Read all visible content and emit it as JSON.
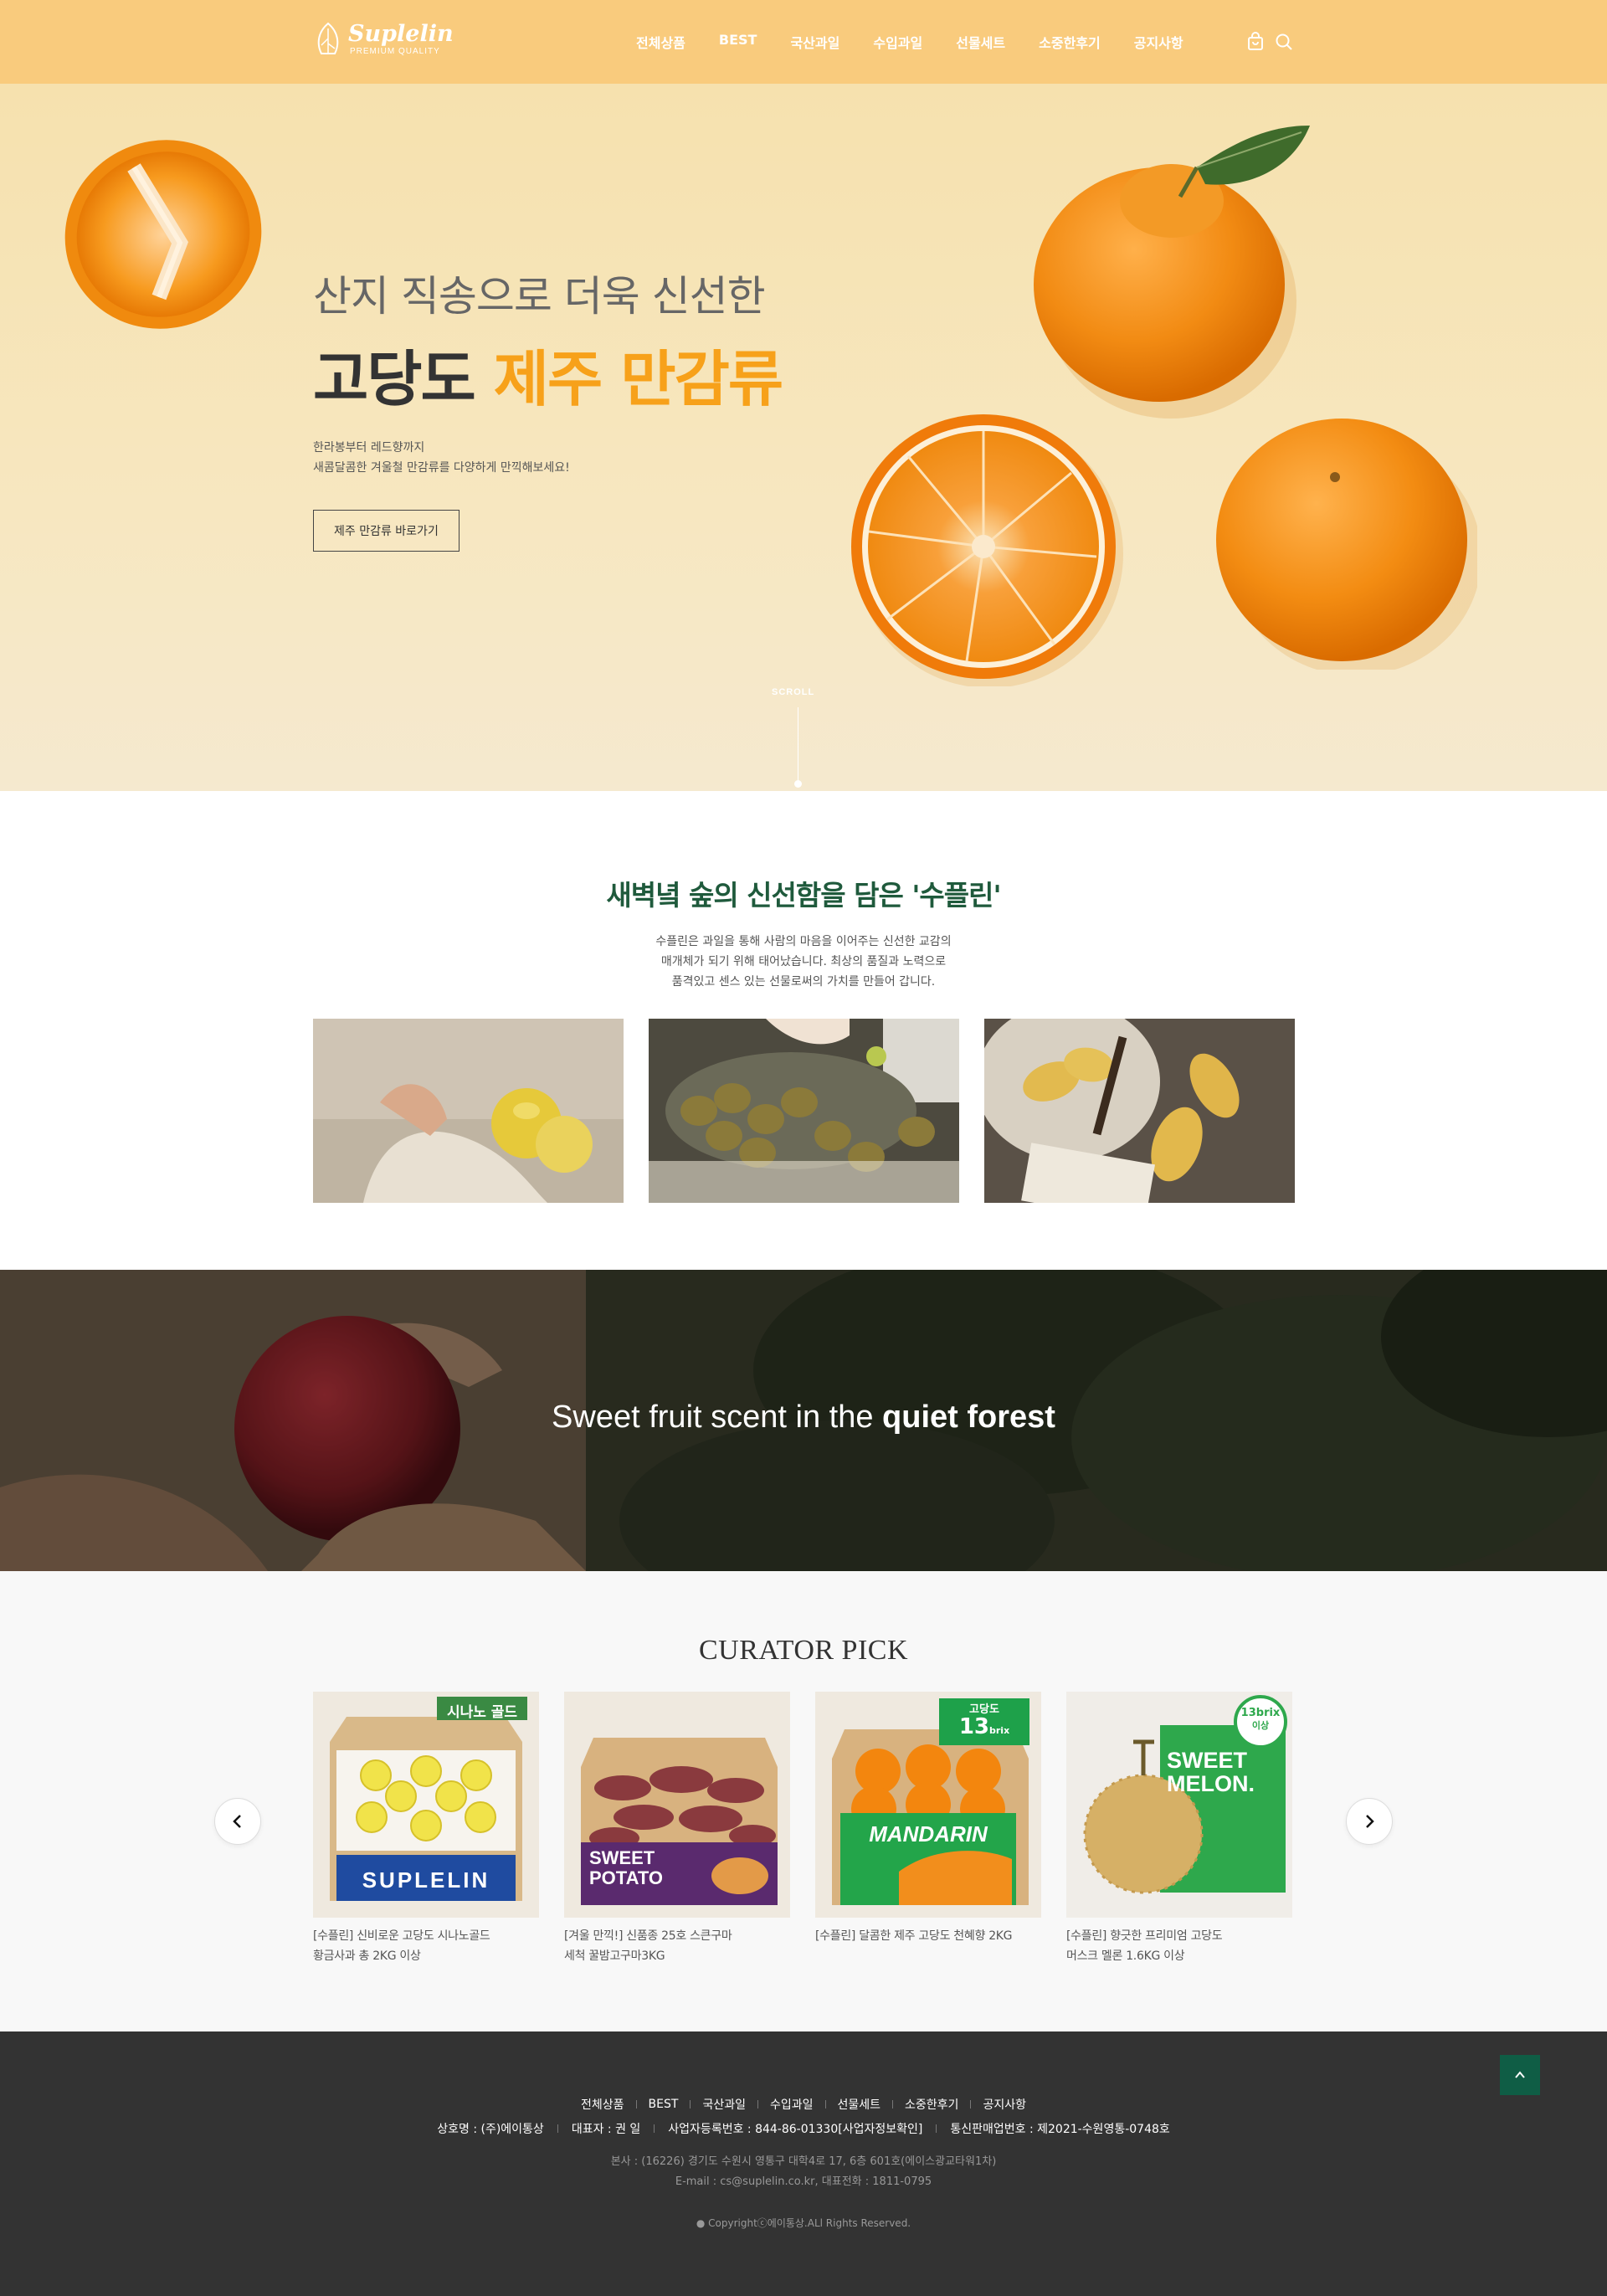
{
  "header": {
    "logo_name": "Suplelin",
    "logo_tagline": "PREMIUM QUALITY",
    "nav": [
      "전체상품",
      "BEST",
      "국산과일",
      "수입과일",
      "선물세트",
      "소중한후기",
      "공지사항"
    ],
    "icons": [
      "shopping-bag-icon",
      "search-icon"
    ],
    "background": "#f9cb7d"
  },
  "hero": {
    "line1": "산지 직송으로 더욱 신선한",
    "line2_plain": "고당도 ",
    "line2_accent": "제주 만감류",
    "accent_color": "#f7a11a",
    "desc_1": "한라봉부터 레드향까지",
    "desc_2": "새콤달콤한 겨울철 만감류를 다양하게 만끽해보세요!",
    "button": "제주 만감류 바로가기",
    "scroll_label": "SCROLL"
  },
  "about": {
    "title_plain": "새벽녘 숲의 신선함을 담은 ",
    "title_accent": "'수플린'",
    "desc_1": "수플린은 과일을 통해 사람의 마음을 이어주는 신선한 교감의",
    "desc_2": "매개체가 되기 위해 태어났습니다. 최상의 품질과 노력으로",
    "desc_3": "품격있고 센스 있는 선물로써의 가치를 만들어 갑니다."
  },
  "banner": {
    "text_plain": "Sweet fruit scent in the ",
    "text_bold": "quiet forest"
  },
  "curator": {
    "title": "CURATOR PICK",
    "products": [
      {
        "name_1": "[수플린] 신비로운 고당도 시나노골드",
        "name_2": "황금사과 총 2KG 이상",
        "badge": "시나노 골드",
        "box_label": "SUPLELIN"
      },
      {
        "name_1": "[겨울 만끽!] 신품종 25호 스큰구마",
        "name_2": "세척 꿀밤고구마3KG",
        "box_label_1": "SWEET",
        "box_label_2": "POTATO"
      },
      {
        "name_1": "[수플린] 달콤한 제주 고당도 천혜향 2KG",
        "name_2": "",
        "badge_1": "고당도",
        "badge_2": "13",
        "badge_3": "brix",
        "box_label": "MANDARIN"
      },
      {
        "name_1": "[수플린] 향긋한 프리미엄 고당도",
        "name_2": "머스크 멜론 1.6KG 이상",
        "badge_1": "13brix",
        "badge_2": "이상",
        "box_label_1": "SWEET",
        "box_label_2": "MELON."
      }
    ]
  },
  "footer": {
    "nav": [
      "전체상품",
      "BEST",
      "국산과일",
      "수입과일",
      "선물세트",
      "소중한후기",
      "공지사항"
    ],
    "company": "상호명 : (주)에이통상",
    "ceo": "대표자 : 권 일",
    "biz_no": "사업자등록번호 : 844-86-01330[사업자정보확인]",
    "mail_order": "통신판매업번호 : 제2021-수원영통-0748호",
    "address": "본사 : (16226) 경기도 수원시 영통구 대학4로 17, 6층 601호(에이스광교타워1차)",
    "contact": "E-mail : cs@suplelin.co.kr, 대표전화 : 1811-0795",
    "copyright": "Copyrightⓒ에이통상.ALl Rights Reserved.",
    "top_button_color": "#0f5d45"
  }
}
